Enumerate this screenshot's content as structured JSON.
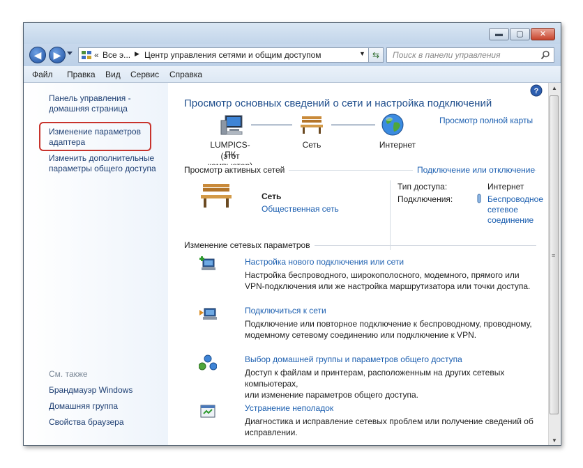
{
  "window": {
    "controls": {
      "minimize": "▬",
      "maximize": "▢",
      "close": "✕"
    },
    "address": {
      "root_crumb": "Все э...",
      "current": "Центр управления сетями и общим доступом"
    },
    "search_placeholder": "Поиск в панели управления"
  },
  "menu": [
    "Файл",
    "Правка",
    "Вид",
    "Сервис",
    "Справка"
  ],
  "sidebar": {
    "home_line1": "Панель управления -",
    "home_line2": "домашняя страница",
    "adapter_line1": "Изменение параметров",
    "adapter_line2": "адаптера",
    "sharing_line1": "Изменить дополнительные",
    "sharing_line2": "параметры общего доступа",
    "see_also": "См. также",
    "links": [
      "Брандмауэр Windows",
      "Домашняя группа",
      "Свойства браузера"
    ]
  },
  "main": {
    "title": "Просмотр основных сведений о сети и настройка подключений",
    "full_map_link": "Просмотр полной карты",
    "map": {
      "computer_name": "LUMPICS-ПК",
      "computer_sub": "(этот компьютер)",
      "network": "Сеть",
      "internet": "Интернет"
    },
    "active_header": "Просмотр активных сетей",
    "connect_link": "Подключение или отключение",
    "active": {
      "name": "Сеть",
      "type_link": "Общественная сеть",
      "access_label": "Тип доступа:",
      "access_value": "Интернет",
      "connections_label": "Подключения:",
      "connection_line1": "Беспроводное",
      "connection_line2": "сетевое",
      "connection_line3": "соединение"
    },
    "change_header": "Изменение сетевых параметров",
    "tasks": [
      {
        "title": "Настройка нового подключения или сети",
        "line1": "Настройка беспроводного, широкополосного, модемного, прямого или",
        "line2": "VPN-подключения или же настройка маршрутизатора или точки доступа."
      },
      {
        "title": "Подключиться к сети",
        "line1": "Подключение или повторное подключение к беспроводному, проводному,",
        "line2": "модемному сетевому соединению или подключение к VPN."
      },
      {
        "title": "Выбор домашней группы и параметров общего доступа",
        "line1": "Доступ к файлам и принтерам, расположенным на других сетевых компьютерах,",
        "line2": "или изменение параметров общего доступа."
      },
      {
        "title": "Устранение неполадок",
        "line1": "Диагностика и исправление сетевых проблем или получение сведений об",
        "line2": "исправлении."
      }
    ]
  }
}
